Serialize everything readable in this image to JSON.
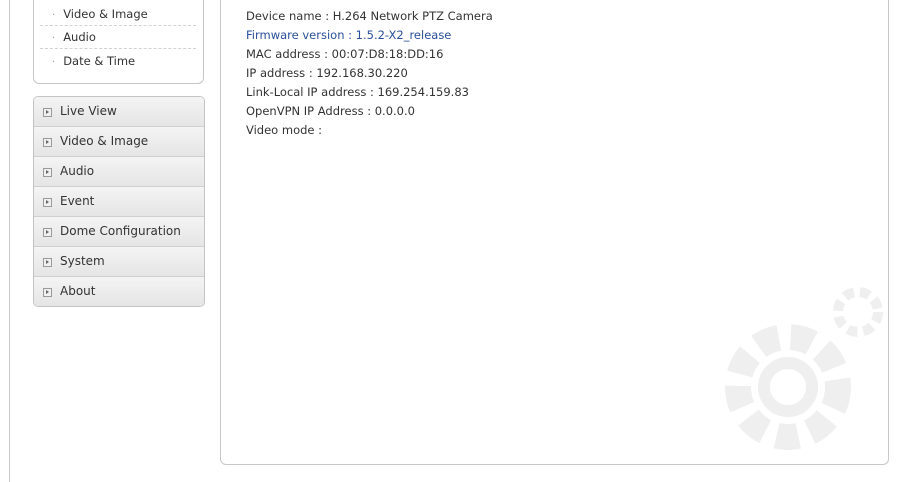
{
  "submenu": {
    "items": [
      {
        "label": "Video & Image"
      },
      {
        "label": "Audio"
      },
      {
        "label": "Date & Time"
      }
    ],
    "bullet": "·"
  },
  "nav": {
    "items": [
      {
        "label": "Live View"
      },
      {
        "label": "Video & Image"
      },
      {
        "label": "Audio"
      },
      {
        "label": "Event"
      },
      {
        "label": "Dome Configuration"
      },
      {
        "label": "System"
      },
      {
        "label": "About"
      }
    ]
  },
  "info": {
    "device_name": "Device name : H.264 Network PTZ Camera",
    "firmware": "Firmware version : 1.5.2-X2_release",
    "mac": "MAC address : 00:07:D8:18:DD:16",
    "ip": "IP address : 192.168.30.220",
    "link_local": "Link-Local IP address : 169.254.159.83",
    "openvpn": "OpenVPN IP Address : 0.0.0.0",
    "video_mode": "Video mode :"
  },
  "colors": {
    "link": "#2a4f9a",
    "text": "#333333",
    "border": "#c8c8c8"
  }
}
